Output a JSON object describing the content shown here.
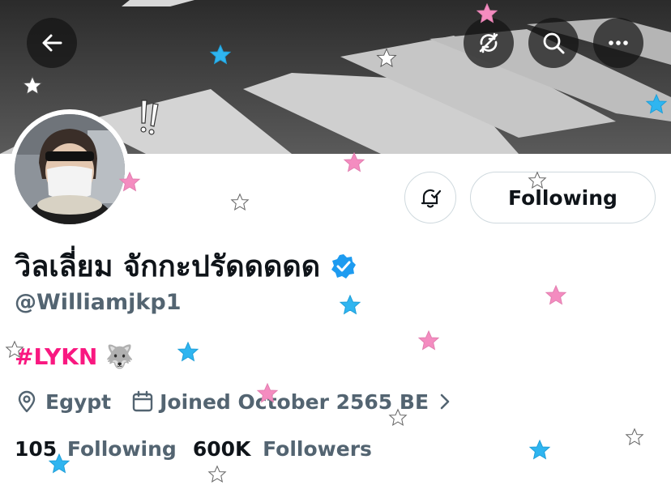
{
  "header": {
    "back_icon": "arrow-left-icon",
    "actions": [
      {
        "icon": "no-retweets-icon"
      },
      {
        "icon": "search-icon"
      },
      {
        "icon": "more-icon"
      }
    ]
  },
  "profile": {
    "display_name": "วิลเลี่ยม จักกะปรัดดดดด",
    "verified": true,
    "handle": "@Williamjkp1",
    "bio_hashtag": "#LYKN",
    "bio_emoji": "🐺",
    "location": "Egypt",
    "joined": "Joined October 2565 BE",
    "following_count": "105",
    "following_label": "Following",
    "followers_count": "600K",
    "followers_label": "Followers"
  },
  "buttons": {
    "follow_state": "Following",
    "bell_icon": "notification-bell-icon"
  },
  "colors": {
    "accent_pink": "#f91880",
    "verified_blue": "#1d9bf0",
    "secondary_text": "#536471",
    "primary_text": "#0f1419"
  }
}
